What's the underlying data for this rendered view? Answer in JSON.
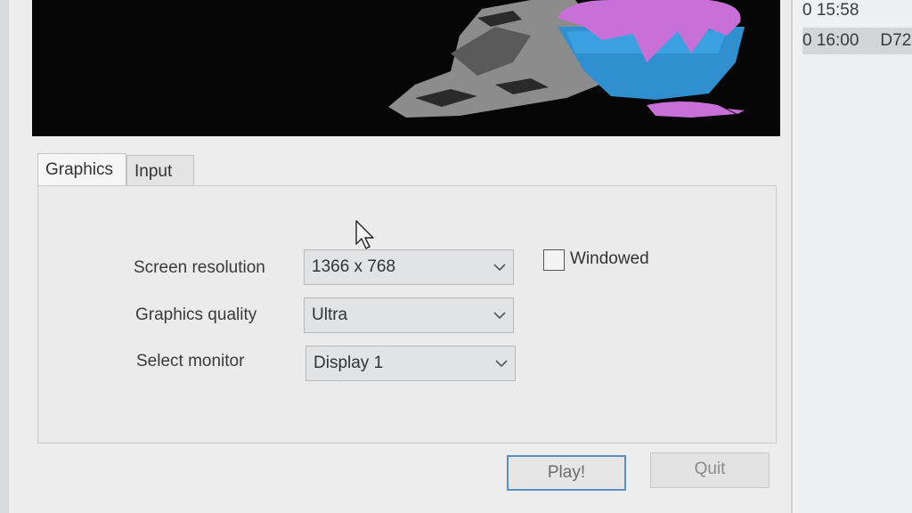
{
  "background_window": {
    "rows": [
      {
        "time": "0 15:58",
        "extra": ""
      },
      {
        "time": "0 16:00",
        "extra": "D72"
      }
    ]
  },
  "launcher": {
    "tabs": [
      {
        "label": "Graphics",
        "active": true
      },
      {
        "label": "Input",
        "active": false
      }
    ],
    "fields": {
      "resolution": {
        "label": "Screen resolution",
        "value": "1366 x 768"
      },
      "quality": {
        "label": "Graphics quality",
        "value": "Ultra"
      },
      "monitor": {
        "label": "Select monitor",
        "value": "Display 1"
      }
    },
    "windowed": {
      "label": "Windowed",
      "checked": false
    },
    "buttons": {
      "play": "Play!",
      "quit": "Quit"
    }
  },
  "colors": {
    "banner_bg": "#060606",
    "bowl_blue": "#2f8fcf",
    "goo_purple": "#c86fd8",
    "focus_blue": "#5a8fc4"
  }
}
